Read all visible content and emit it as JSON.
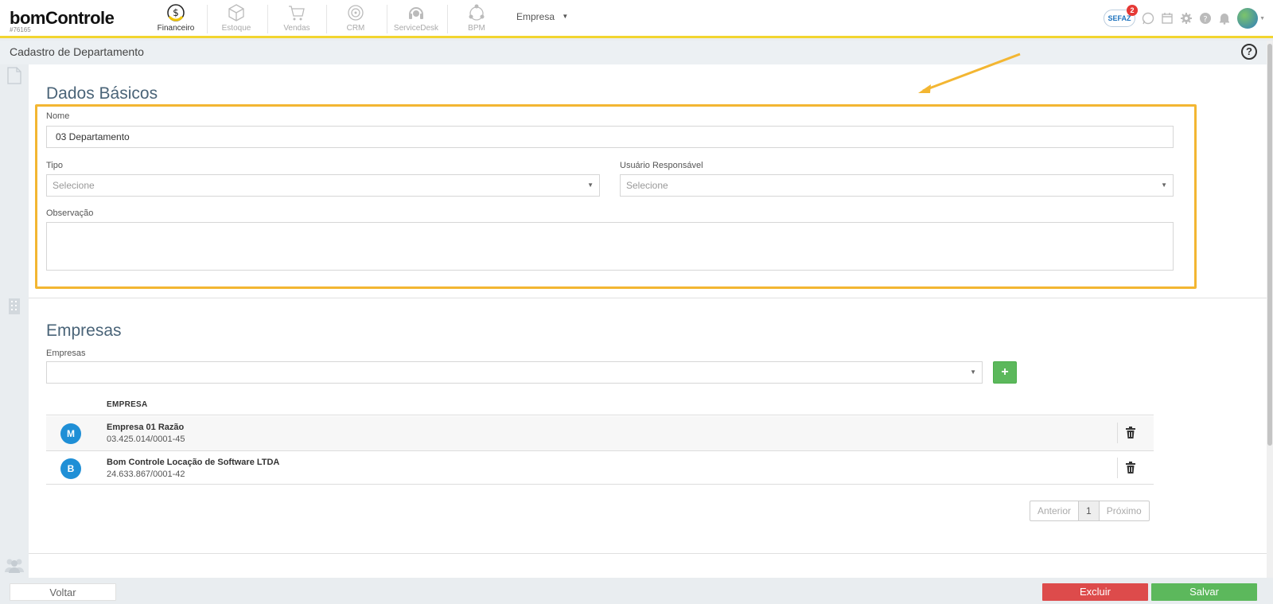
{
  "brand": {
    "logo": "bomControle",
    "account_id": "#76165"
  },
  "nav": {
    "modules": [
      {
        "label": "Financeiro",
        "icon": "dollar-coin-icon",
        "active": true
      },
      {
        "label": "Estoque",
        "icon": "box-icon",
        "active": false
      },
      {
        "label": "Vendas",
        "icon": "cart-icon",
        "active": false
      },
      {
        "label": "CRM",
        "icon": "target-icon",
        "active": false
      },
      {
        "label": "ServiceDesk",
        "icon": "headset-icon",
        "active": false
      },
      {
        "label": "BPM",
        "icon": "process-icon",
        "active": false
      }
    ],
    "empresa_menu": "Empresa",
    "sefaz_label": "SEFAZ",
    "sefaz_badge": "2"
  },
  "page": {
    "title": "Cadastro de Departamento",
    "help_icon": "?"
  },
  "dados_basicos": {
    "title": "Dados Básicos",
    "nome_label": "Nome",
    "nome_value": "03 Departamento",
    "tipo_label": "Tipo",
    "tipo_value": "Selecione",
    "usuario_label": "Usuário Responsável",
    "usuario_value": "Selecione",
    "observacao_label": "Observação",
    "observacao_value": ""
  },
  "empresas": {
    "title": "Empresas",
    "select_label": "Empresas",
    "add_button": "+",
    "column_header": "EMPRESA",
    "rows": [
      {
        "initial": "M",
        "name": "Empresa 01 Razão",
        "cnpj": "03.425.014/0001-45"
      },
      {
        "initial": "B",
        "name": "Bom Controle Locação de Software LTDA",
        "cnpj": "24.633.867/0001-42"
      }
    ],
    "pagination": {
      "prev": "Anterior",
      "current": "1",
      "next": "Próximo"
    }
  },
  "footer": {
    "voltar": "Voltar",
    "excluir": "Excluir",
    "salvar": "Salvar"
  },
  "colors": {
    "accent_yellow": "#f2d530",
    "highlight": "#f3b632",
    "success": "#5cb85c",
    "danger": "#dd4b4b",
    "avatar_blue": "#1f8fd6"
  }
}
